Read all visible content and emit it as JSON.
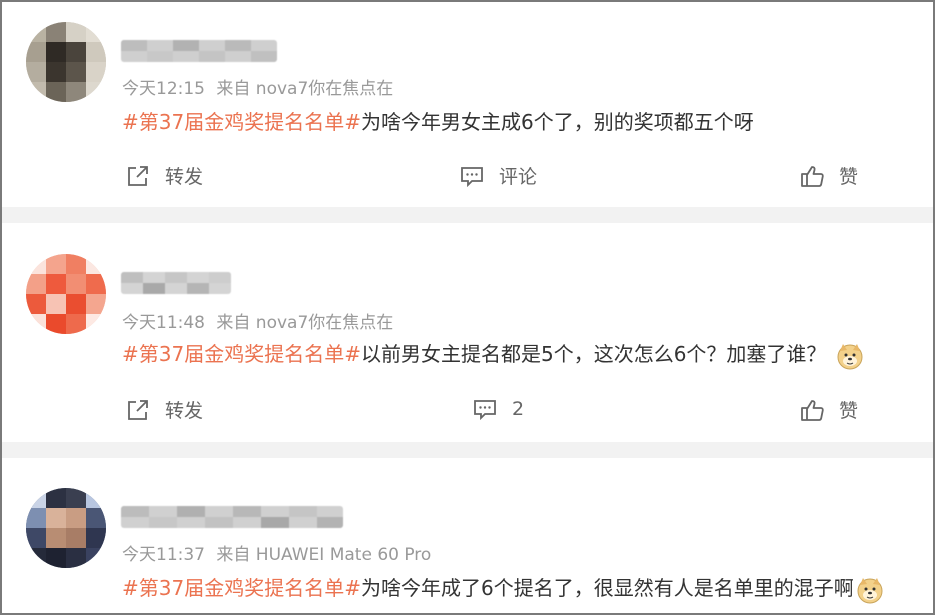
{
  "posts": [
    {
      "time": "今天12:15",
      "source": "来自 nova7你在焦点在",
      "hashtag": "#第37届金鸡奖提名名单#",
      "text": "为啥今年男女主成6个了，别的奖项都五个呀",
      "actions": {
        "repost": "转发",
        "comment": "评论",
        "like": "赞"
      }
    },
    {
      "time": "今天11:48",
      "source": "来自 nova7你在焦点在",
      "hashtag": "#第37届金鸡奖提名名单#",
      "text": "以前男女主提名都是5个，这次怎么6个？加塞了谁？",
      "emoji": "doge-emoji",
      "actions": {
        "repost": "转发",
        "comment": "2",
        "like": "赞"
      }
    },
    {
      "time": "今天11:37",
      "source": "来自 HUAWEI Mate 60 Pro",
      "hashtag": "#第37届金鸡奖提名名单#",
      "text": "为啥今年成了6个提名了，很显然有人是名单里的混子啊",
      "emoji": "doge-emoji"
    }
  ],
  "colors": {
    "hashtag": "#eb7350",
    "meta": "#999999",
    "separator": "#f2f2f2"
  }
}
